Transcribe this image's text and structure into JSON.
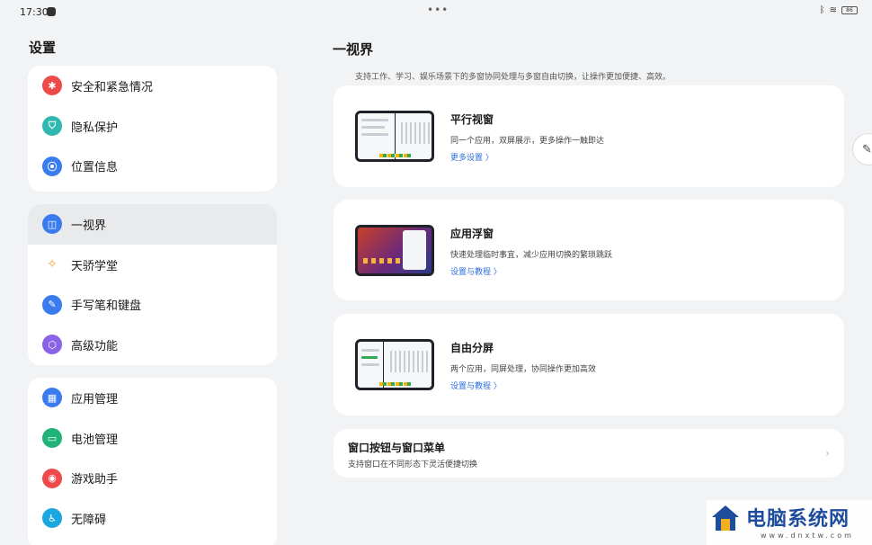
{
  "status": {
    "time": "17:30",
    "battery": "86"
  },
  "left": {
    "title": "设置",
    "groups": [
      [
        {
          "label": "安全和紧急情况",
          "icon": "asterisk-icon"
        },
        {
          "label": "隐私保护",
          "icon": "shield-icon"
        },
        {
          "label": "位置信息",
          "icon": "location-pin-icon"
        }
      ],
      [
        {
          "label": "一视界",
          "icon": "split-view-icon"
        },
        {
          "label": "天骄学堂",
          "icon": "handshake-icon"
        },
        {
          "label": "手写笔和键盘",
          "icon": "pen-icon"
        },
        {
          "label": "高级功能",
          "icon": "advanced-icon"
        }
      ],
      [
        {
          "label": "应用管理",
          "icon": "grid-apps-icon"
        },
        {
          "label": "电池管理",
          "icon": "battery-icon"
        },
        {
          "label": "游戏助手",
          "icon": "gamepad-icon"
        },
        {
          "label": "无障碍",
          "icon": "accessibility-icon"
        }
      ]
    ]
  },
  "right": {
    "title": "一视界",
    "description": "支持工作、学习、娱乐场景下的多窗协同处理与多窗自由切换，让操作更加便捷、高效。",
    "cards": [
      {
        "title": "平行视窗",
        "desc": "同一个应用，双屏展示，更多操作一触即达",
        "link": "更多设置 〉"
      },
      {
        "title": "应用浮窗",
        "desc": "快速处理临时事宜，减少应用切换的繁琐跳跃",
        "link": "设置与教程 〉"
      },
      {
        "title": "自由分屏",
        "desc": "两个应用，同屏处理，协同操作更加高效",
        "link": "设置与教程 〉"
      }
    ],
    "window_card": {
      "title": "窗口按钮与窗口菜单",
      "desc": "支持窗口在不同形态下灵活便捷切换"
    }
  },
  "watermark": {
    "title": "电脑系统网",
    "subtitle": "www.dnxtw.com"
  },
  "colors": {
    "accent": "#2f6fe0",
    "background": "#f2f3f5"
  }
}
